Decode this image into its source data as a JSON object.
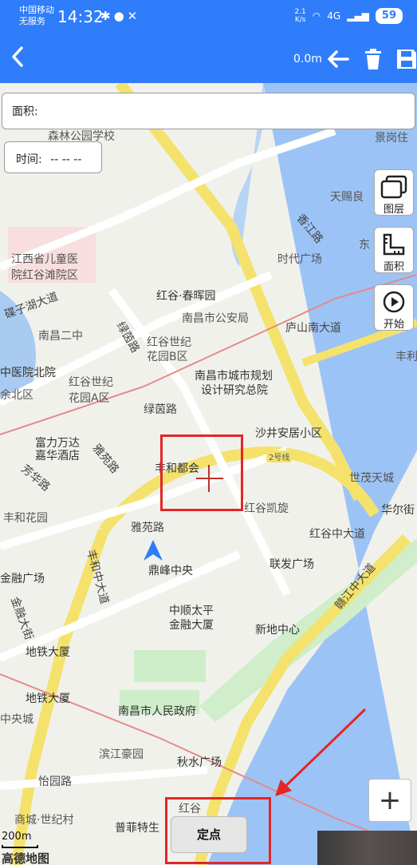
{
  "status_bar": {
    "carrier": "中国移动",
    "service": "无服务",
    "time": "14:32",
    "net_speed_top": "2.1",
    "net_speed_unit": "K/s",
    "network_type": "4G",
    "battery": "59"
  },
  "toolbar": {
    "distance": "0.0m",
    "color": "#2f7dfa"
  },
  "area": {
    "label": "面积:"
  },
  "time_panel": {
    "label": "时间:",
    "value": "-- -- --"
  },
  "side_buttons": [
    {
      "label": "图层",
      "icon": "layers-icon"
    },
    {
      "label": "面积",
      "icon": "ruler-icon"
    },
    {
      "label": "开始",
      "icon": "play-icon"
    }
  ],
  "map": {
    "pois": [
      "森林公园学校",
      "景岗住",
      "天赐良",
      "香江路",
      "东",
      "时代广场",
      "江西省儿童医",
      "院红谷滩院区",
      "碟子湖大道",
      "红谷·春晖园",
      "南昌市公安局",
      "庐山南大道",
      "南昌二中",
      "绿茵路",
      "红谷世纪",
      "花园B区",
      "丰利",
      "中医院北院",
      "红谷世纪",
      "花园A区",
      "南昌市城市规划",
      "设计研究总院",
      "绿茵路",
      "沙井安居小区",
      "富力万达",
      "嘉华酒店",
      "雅苑路",
      "丰和都会",
      "芳华路",
      "世茂天城",
      "丰和花园",
      "红谷凯旋",
      "华尔街",
      "雅苑路",
      "红谷中大道",
      "丰和中大道",
      "联发广场",
      "金融广场",
      "鼎峰中央",
      "赣江中大道",
      "金融大街",
      "中顺太平",
      "金融大厦",
      "新地中心",
      "地铁大厦",
      "地铁大厦",
      "南昌市人民政府",
      "中央城",
      "滨江豪园",
      "秋水广场",
      "怡园路",
      "商城·世纪村",
      "普菲特生",
      "红谷",
      "余北区",
      "2号线"
    ]
  },
  "scale": {
    "label": "200m"
  },
  "logo": "高德地图",
  "zoom": {
    "plus": "+"
  },
  "locate_button": {
    "label": "定点"
  }
}
